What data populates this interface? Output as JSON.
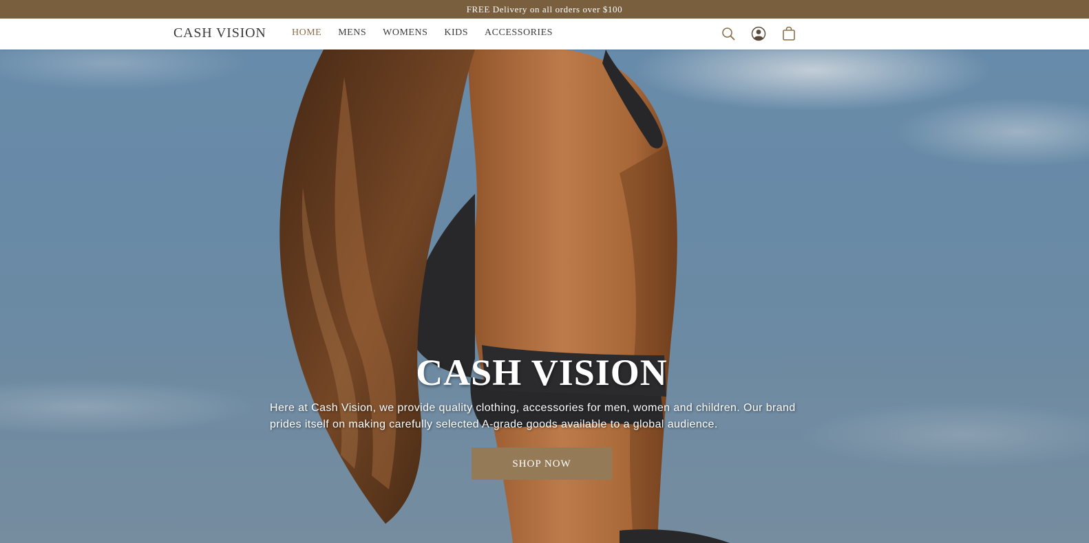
{
  "announcement": {
    "text": "FREE Delivery on all orders over $100"
  },
  "header": {
    "logo": "CASH VISION",
    "nav": [
      {
        "label": "HOME",
        "active": true
      },
      {
        "label": "MENS",
        "active": false
      },
      {
        "label": "WOMENS",
        "active": false
      },
      {
        "label": "KIDS",
        "active": false
      },
      {
        "label": "ACCESSORIES",
        "active": false
      }
    ],
    "icons": [
      "search-icon",
      "account-icon",
      "shopping-bag-icon"
    ]
  },
  "hero": {
    "title": "CASH VISION",
    "text": "Here at Cash Vision, we provide quality clothing, accessories for men, women and children. Our brand prides itself on making carefully selected A-grade goods available to a global audience.",
    "cta_label": "SHOP NOW"
  },
  "colors": {
    "brand_brown": "#7a5f3e",
    "accent": "#8a6d47",
    "button": "#957a58",
    "sky": "#7397b5"
  }
}
